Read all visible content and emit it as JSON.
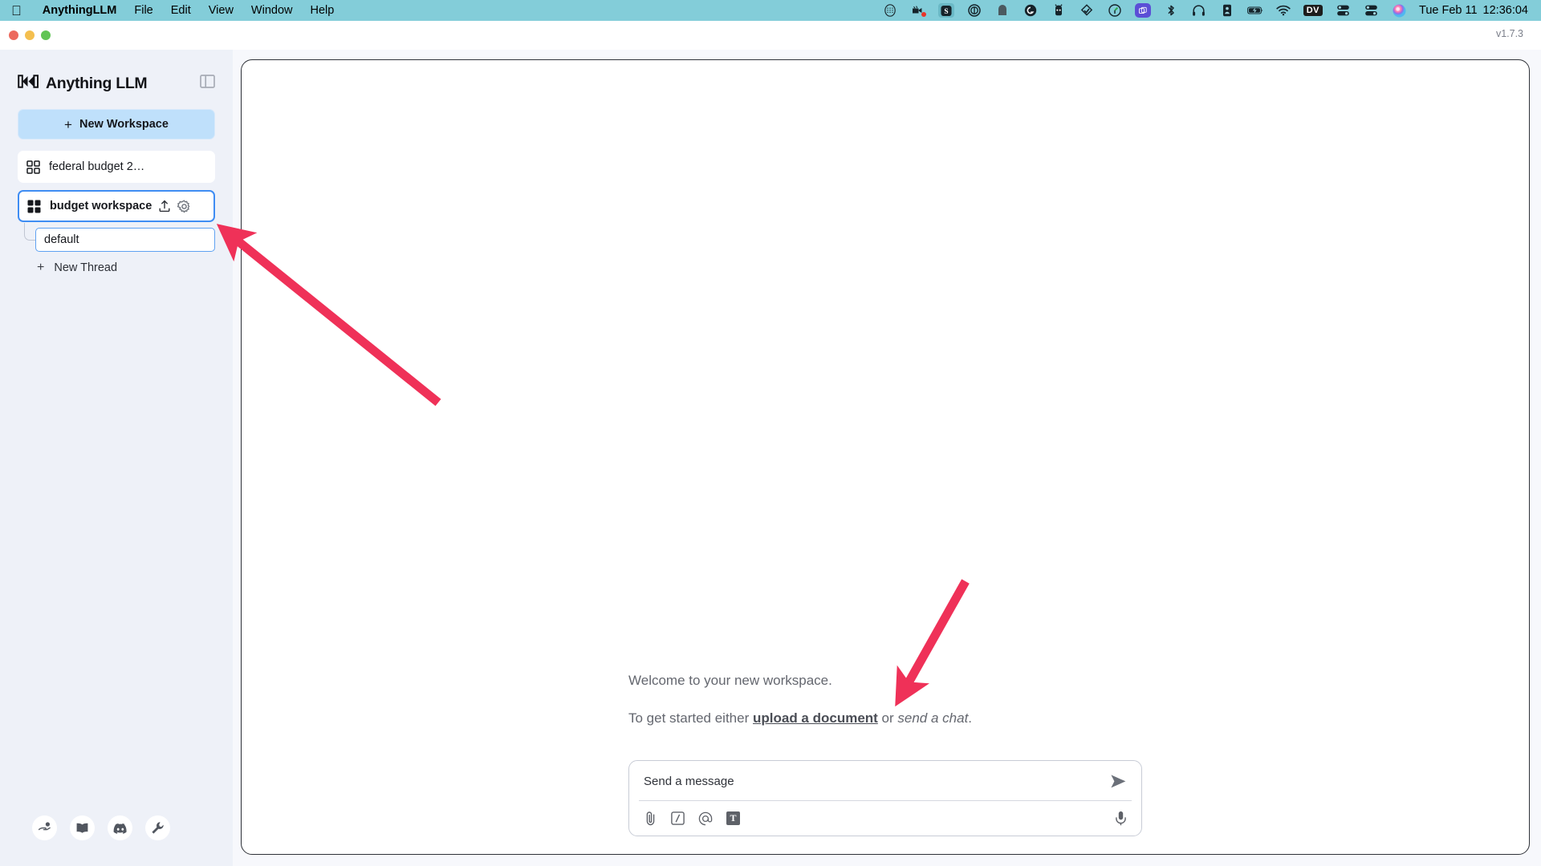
{
  "menubar": {
    "apple_label": "Apple menu",
    "app_name": "AnythingLLM",
    "menus": [
      "File",
      "Edit",
      "View",
      "Window",
      "Help"
    ],
    "tray_icons": [
      "grid-keyboard-icon",
      "screen-recording-icon",
      "setapp-icon",
      "zero-circle-icon",
      "arc-icon",
      "grammarly-icon",
      "ollama-icon",
      "tailscale-icon",
      "time-tracker-icon",
      "window-manager-icon",
      "bluetooth-icon",
      "headphones-icon",
      "device-icon",
      "battery-charging-icon",
      "wifi-icon",
      "dv-badge-icon",
      "server-toggle-icon",
      "control-center-icon",
      "siri-icon"
    ],
    "dv_badge": "DV",
    "clock_date": "Tue Feb 11",
    "clock_time": "12:36:04",
    "background_color": "#83cdd9"
  },
  "window": {
    "traffic_lights": [
      "close",
      "minimize",
      "zoom"
    ],
    "version": "v1.7.3"
  },
  "sidebar": {
    "brand": "Anything LLM",
    "brand_logo_icon": "anything-llm-logo-icon",
    "panel_toggle_icon": "sidebar-toggle-icon",
    "new_workspace_label": "New Workspace",
    "workspaces": [
      {
        "name": "federal budget 2…",
        "icon": "grid-outline-icon",
        "selected": false
      },
      {
        "name": "budget workspace",
        "icon": "grid-filled-icon",
        "selected": true
      }
    ],
    "workspace_actions": [
      "upload-icon",
      "gear-icon"
    ],
    "thread_name": "default",
    "new_thread_label": "New Thread",
    "footer_icons": [
      "hand-heart-icon",
      "book-icon",
      "discord-icon",
      "wrench-icon"
    ],
    "background_color": "#eef1f8",
    "selected_border_color": "#3f8df3",
    "new_workspace_color": "#bfe0fb"
  },
  "main": {
    "welcome_text": "Welcome to your new workspace.",
    "get_started_prefix": "To get started either ",
    "upload_link": "upload a document",
    "get_started_mid": " or ",
    "send_chat_text": "send a chat",
    "get_started_suffix": ".",
    "composer": {
      "placeholder": "Send a message",
      "value": "",
      "send_icon": "send-arrow-icon",
      "tools": [
        "paperclip-icon",
        "slash-command-icon",
        "at-mention-icon",
        "text-format-icon"
      ],
      "mic_icon": "microphone-icon"
    }
  },
  "annotations": {
    "color": "#ef3158",
    "arrows": [
      {
        "name": "arrow-to-budget-workspace",
        "points_to": "budget workspace sidebar item"
      },
      {
        "name": "arrow-to-upload-a-document",
        "points_to": "upload a document link"
      }
    ]
  }
}
